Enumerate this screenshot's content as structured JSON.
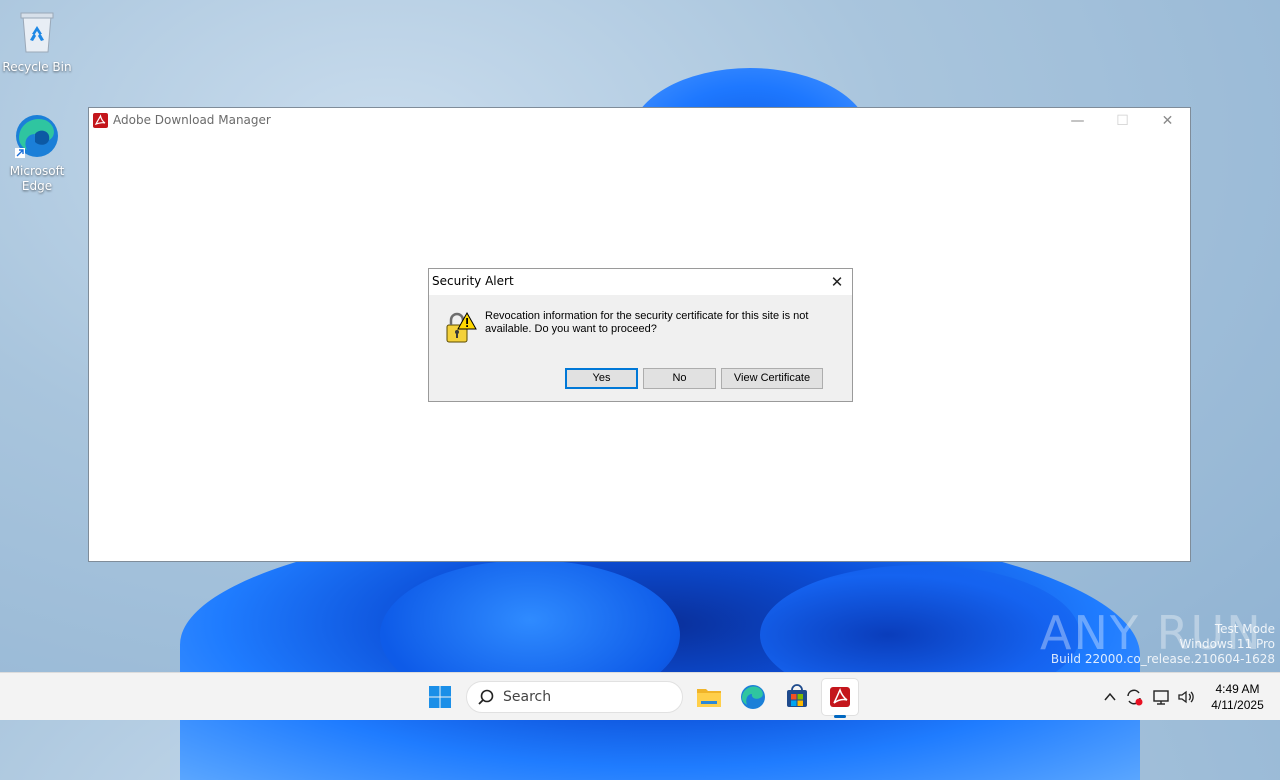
{
  "desktop": {
    "icons": [
      {
        "label": "Recycle Bin",
        "icon": "recycle-bin-icon"
      },
      {
        "label": "Microsoft Edge",
        "icon": "edge-icon"
      }
    ]
  },
  "window": {
    "title": "Adobe Download Manager",
    "icon": "adobe-acrobat-icon",
    "controls": {
      "minimize": "—",
      "maximize": "☐",
      "close": "✕"
    }
  },
  "dialog": {
    "title": "Security Alert",
    "close": "✕",
    "icon": "warning-lock-icon",
    "message": "Revocation information for the security certificate for this site is not available. Do you want to proceed?",
    "buttons": {
      "yes": "Yes",
      "no": "No",
      "view_certificate": "View Certificate"
    }
  },
  "watermark": {
    "logo": "ANY RUN",
    "lines": [
      "Test Mode",
      "Windows 11 Pro",
      "Build 22000.co_release.210604-1628"
    ]
  },
  "taskbar": {
    "search_label": "Search",
    "apps": [
      "start-icon",
      "file-explorer-icon",
      "edge-icon",
      "store-icon",
      "adobe-acrobat-icon"
    ],
    "tray": [
      "chevron-up-icon",
      "sync-icon",
      "network-icon",
      "volume-icon"
    ],
    "time": "4:49 AM",
    "date": "4/11/2025"
  },
  "colors": {
    "accent": "#0078d7",
    "adobe_red": "#c4161c"
  }
}
